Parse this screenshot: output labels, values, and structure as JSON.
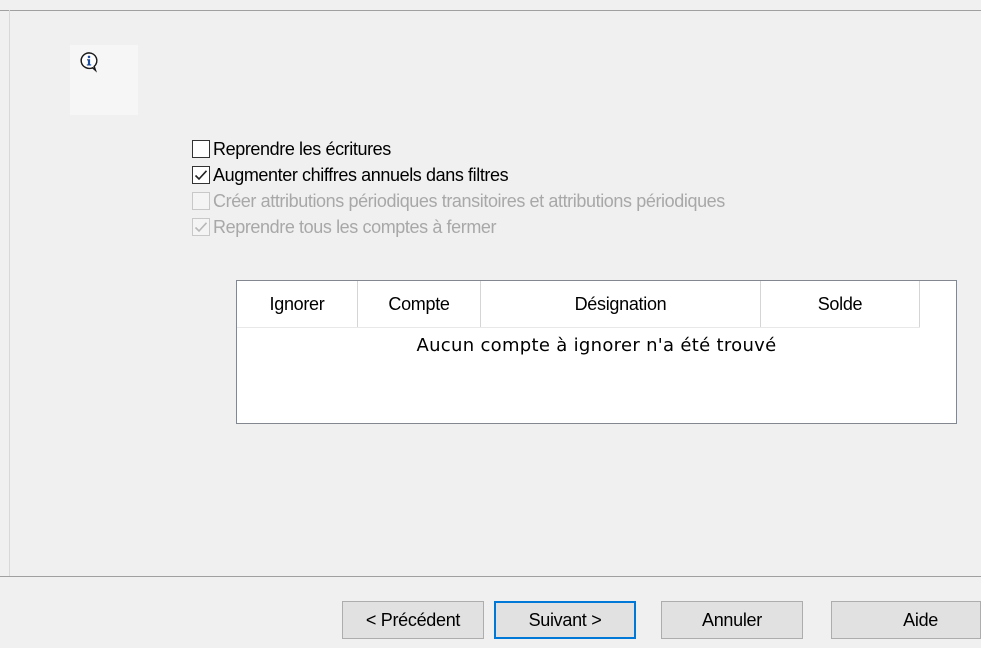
{
  "options": [
    {
      "label": "Reprendre les écritures",
      "checked": false,
      "enabled": true
    },
    {
      "label": "Augmenter chiffres annuels dans filtres",
      "checked": true,
      "enabled": true
    },
    {
      "label": "Créer attributions périodiques transitoires et attributions périodiques",
      "checked": false,
      "enabled": false
    },
    {
      "label": "Reprendre tous les comptes à fermer",
      "checked": true,
      "enabled": false
    }
  ],
  "table": {
    "columns": [
      "Ignorer",
      "Compte",
      "Désignation",
      "Solde"
    ],
    "empty_message": "Aucun compte à ignorer n'a été trouvé"
  },
  "buttons": {
    "previous": "< Précédent",
    "next": "Suivant >",
    "cancel": "Annuler",
    "help": "Aide"
  },
  "icons": {
    "info": "info-icon"
  },
  "colors": {
    "accent": "#0078d7",
    "background": "#f0f0f0",
    "disabled_text": "#a8a8a8"
  }
}
